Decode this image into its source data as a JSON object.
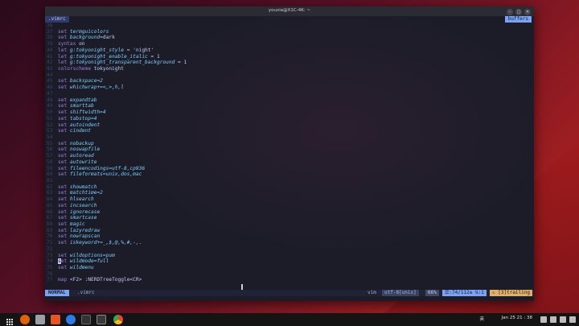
{
  "window": {
    "title": "youxia@X1C-4K: ~",
    "minimize": "–",
    "maximize": "□",
    "close": "✕"
  },
  "tabline": {
    "active_tab": ".vimrc",
    "right_label": "buffers"
  },
  "lines": [
    {
      "n": "36",
      "t": ""
    },
    {
      "n": "37",
      "k": "set",
      "o": "termguicolors",
      "r": ""
    },
    {
      "n": "38",
      "k": "set",
      "o": "background",
      "r": "=dark"
    },
    {
      "n": "39",
      "k": "syntax",
      "o": "",
      "r": " on"
    },
    {
      "n": "40",
      "k": "let",
      "o": "g:tokyonight_style",
      "r": " = 'night'"
    },
    {
      "n": "41",
      "k": "let",
      "o": "g:tokyonight_enable_italic",
      "r": " = 1"
    },
    {
      "n": "42",
      "k": "let",
      "o": "g:tokyonight_transparent_background",
      "r": " = 1"
    },
    {
      "n": "43",
      "k": "colorscheme",
      "o": "",
      "r": " tokyonight"
    },
    {
      "n": "44",
      "t": ""
    },
    {
      "n": "45",
      "k": "set",
      "o": "backspace=2",
      "r": ""
    },
    {
      "n": "46",
      "k": "set",
      "o": "whichwrap+=<,>,h,l",
      "r": ""
    },
    {
      "n": "47",
      "t": ""
    },
    {
      "n": "48",
      "k": "set",
      "o": "expandtab",
      "r": ""
    },
    {
      "n": "49",
      "k": "set",
      "o": "smarttab",
      "r": ""
    },
    {
      "n": "50",
      "k": "set",
      "o": "shiftwidth=4",
      "r": ""
    },
    {
      "n": "51",
      "k": "set",
      "o": "tabstop=4",
      "r": ""
    },
    {
      "n": "52",
      "k": "set",
      "o": "autoindent",
      "r": ""
    },
    {
      "n": "53",
      "k": "set",
      "o": "cindent",
      "r": ""
    },
    {
      "n": "54",
      "t": ""
    },
    {
      "n": "55",
      "k": "set",
      "o": "nobackup",
      "r": ""
    },
    {
      "n": "56",
      "k": "set",
      "o": "noswapfile",
      "r": ""
    },
    {
      "n": "57",
      "k": "set",
      "o": "autoread",
      "r": ""
    },
    {
      "n": "58",
      "k": "set",
      "o": "autowrite",
      "r": ""
    },
    {
      "n": "59",
      "k": "set",
      "o": "fileencodings=utf-8,cp936",
      "r": ""
    },
    {
      "n": "60",
      "k": "set",
      "o": "fileformats=unix,dos,mac",
      "r": ""
    },
    {
      "n": "61",
      "t": ""
    },
    {
      "n": "62",
      "k": "set",
      "o": "showmatch",
      "r": ""
    },
    {
      "n": "63",
      "k": "set",
      "o": "matchtime=2",
      "r": ""
    },
    {
      "n": "64",
      "k": "set",
      "o": "hlsearch",
      "r": ""
    },
    {
      "n": "65",
      "k": "set",
      "o": "incsearch",
      "r": ""
    },
    {
      "n": "66",
      "k": "set",
      "o": "ignorecase",
      "r": ""
    },
    {
      "n": "67",
      "k": "set",
      "o": "smartcase",
      "r": ""
    },
    {
      "n": "68",
      "k": "set",
      "o": "magic",
      "r": ""
    },
    {
      "n": "69",
      "k": "set",
      "o": "lazyredraw",
      "r": ""
    },
    {
      "n": "70",
      "k": "set",
      "o": "nowrapscan",
      "r": ""
    },
    {
      "n": "71",
      "k": "set",
      "o": "iskeyword+=_,$,@,%,#,-,.",
      "r": ""
    },
    {
      "n": "72",
      "t": ""
    },
    {
      "n": "73",
      "k": "set",
      "o": "wildoptions=pum",
      "r": ""
    },
    {
      "n": "74",
      "k": "set",
      "o": "wildmode=full",
      "r": "",
      "cursor": true
    },
    {
      "n": "75",
      "k": "set",
      "o": "wildmenu",
      "r": ""
    },
    {
      "n": "76",
      "t": ""
    },
    {
      "n": "77",
      "k": "map",
      "o": "",
      "r": " <F2> :NERDTreeToggle<CR>"
    }
  ],
  "statusline": {
    "mode": "NORMAL",
    "filename": ".vimrc",
    "filetype": "vim",
    "encoding": "utf-8[unix]",
    "percent": "66%",
    "position": "☰:74/112≡ ℅:1",
    "trailing": "⚠ [3]trailing"
  },
  "taskbar": {
    "clock": "Jan 25  21 : 38",
    "ime": "英"
  },
  "colors": {
    "accent": "#7aa2f7",
    "keyword": "#9d7cd8",
    "option": "#7dcfff",
    "bg": "#1b1c28",
    "warning": "#e0af68"
  }
}
